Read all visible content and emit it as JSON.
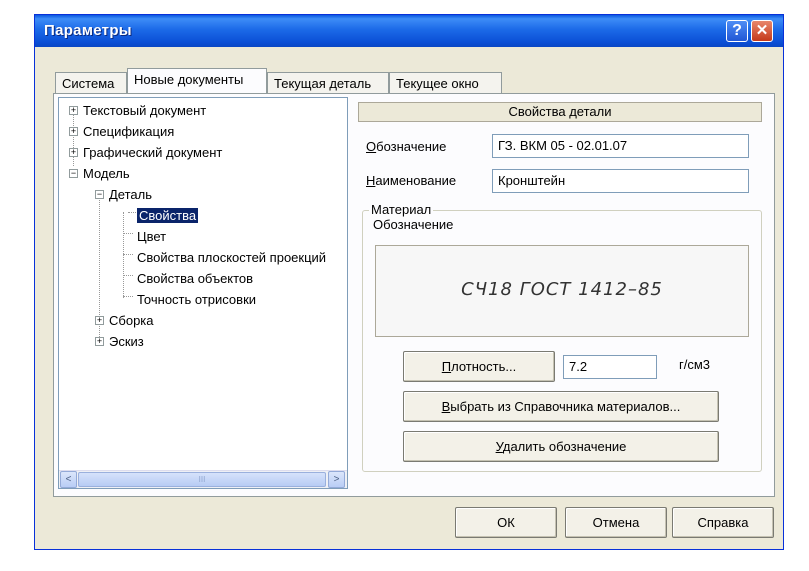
{
  "window": {
    "title": "Параметры",
    "help_glyph": "?",
    "close_glyph": "✕"
  },
  "tabs": [
    {
      "label": "Система"
    },
    {
      "label": "Новые документы",
      "active": true
    },
    {
      "label": "Текущая деталь"
    },
    {
      "label": "Текущее окно"
    }
  ],
  "tree": {
    "items": [
      {
        "label": "Текстовый документ",
        "expander": "+"
      },
      {
        "label": "Спецификация",
        "expander": "+"
      },
      {
        "label": "Графический документ",
        "expander": "+"
      },
      {
        "label": "Модель",
        "expander": "−"
      },
      {
        "label": "Деталь",
        "expander": "−"
      },
      {
        "label": "Свойства",
        "selected": true
      },
      {
        "label": "Цвет"
      },
      {
        "label": "Свойства плоскостей проекций"
      },
      {
        "label": "Свойства объектов"
      },
      {
        "label": "Точность отрисовки"
      },
      {
        "label": "Сборка",
        "expander": "+"
      },
      {
        "label": "Эскиз",
        "expander": "+"
      }
    ],
    "scroll_left": "<",
    "scroll_right": ">",
    "scroll_grip": "III"
  },
  "panel": {
    "header": "Свойства детали",
    "designation_label_ul": "О",
    "designation_label_rest": "бозначение",
    "designation_value": "ГЗ. ВКМ 05 - 02.01.07",
    "name_label_ul": "Н",
    "name_label_rest": "аименование",
    "name_value": "Кронштейн",
    "material_group": "Материал",
    "material_designation_label": "Обозначение",
    "material_value": "СЧ18  ГОСТ 1412–85",
    "density_button_ul": "П",
    "density_button_rest": "лотность...",
    "density_value": "7.2",
    "density_unit": "г/см3",
    "choose_button_ul": "В",
    "choose_button_rest": "ыбрать из Справочника материалов...",
    "delete_button_ul": "У",
    "delete_button_rest": "далить обозначение"
  },
  "buttons": {
    "ok": "ОК",
    "cancel": "Отмена",
    "help": "Справка"
  },
  "colors": {
    "title_bar": "#0b4fd6",
    "selection": "#0a246a",
    "dialog_bg": "#ece9d8"
  }
}
